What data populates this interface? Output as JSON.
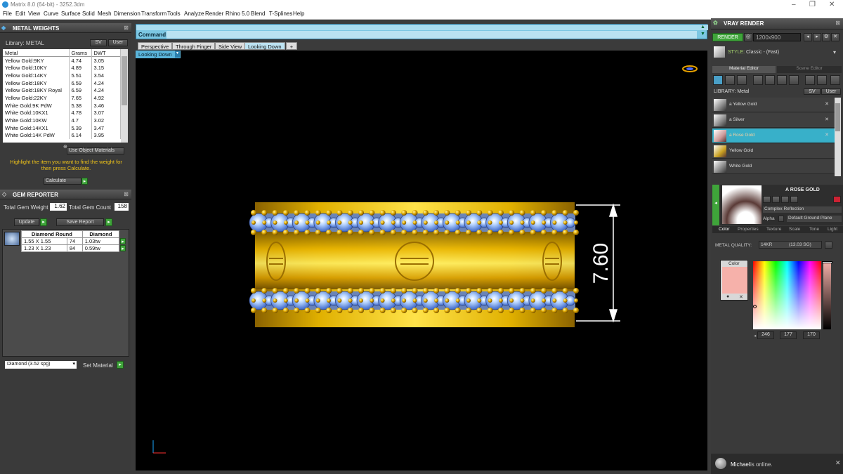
{
  "window": {
    "title": "Matrix 8.0 (64-bit) - 3252.3dm"
  },
  "menu": [
    "File",
    "Edit",
    "View",
    "Curve",
    "Surface",
    "Solid",
    "Mesh",
    "Dimension",
    "Transform",
    "Tools",
    "Analyze",
    "Render",
    "Rhino 5.0",
    "Blend",
    "T-Splines",
    "Help"
  ],
  "metal_weights": {
    "title": "METAL WEIGHTS",
    "library_label": "Library: METAL",
    "sv": "SV",
    "user": "User",
    "columns": [
      "Metal",
      "Grams",
      "DWT"
    ],
    "rows": [
      [
        "Yellow Gold:9KY",
        "4.74",
        "3.05"
      ],
      [
        "Yellow Gold:10KY",
        "4.89",
        "3.15"
      ],
      [
        "Yellow Gold:14KY",
        "5.51",
        "3.54"
      ],
      [
        "Yellow Gold:18KY",
        "6.59",
        "4.24"
      ],
      [
        "Yellow Gold:18KY Royal",
        "6.59",
        "4.24"
      ],
      [
        "Yellow Gold:22KY",
        "7.65",
        "4.92"
      ],
      [
        "White Gold:9K PdW",
        "5.38",
        "3.46"
      ],
      [
        "White Gold:10KX1",
        "4.78",
        "3.07"
      ],
      [
        "White Gold:10KW",
        "4.7",
        "3.02"
      ],
      [
        "White Gold:14KX1",
        "5.39",
        "3.47"
      ],
      [
        "White Gold:14K PdW",
        "6.14",
        "3.95"
      ]
    ],
    "use_object_materials": "Use Object Materials",
    "instruction": "Highlight the item you want to find the weight for then press Calculate.",
    "calculate": "Calculate"
  },
  "gem_reporter": {
    "title": "GEM REPORTER",
    "total_weight_label": "Total Gem Weight",
    "total_weight": "1.62",
    "total_count_label": "Total Gem Count",
    "total_count": "158",
    "update": "Update",
    "save_report": "Save Report",
    "columns": [
      "Diamond Round",
      "Diamond"
    ],
    "rows": [
      [
        "1.55 X 1.55",
        "74",
        "1.03tw"
      ],
      [
        "1.23 X 1.23",
        "84",
        "0.59tw"
      ]
    ],
    "material_select": "Diamond   (3.52 spg)",
    "set_material": "Set Material"
  },
  "command": {
    "label": "Command:"
  },
  "viewport": {
    "tabs": [
      "Perspective",
      "Through Finger",
      "Side View",
      "Looking Down"
    ],
    "add_tab": "+",
    "active_view": "Looking Down",
    "dimension": "7.60"
  },
  "vray": {
    "title": "VRAY RENDER",
    "render": "RENDER",
    "resolution": "1200x900",
    "style_label": "STYLE:",
    "style": "Classic - (Fast)",
    "tabs": [
      "Material Editor",
      "Scene Editor"
    ],
    "library_label": "LIBRARY: Metal",
    "materials": [
      "a Yellow Gold",
      "a Silver",
      "a Rose Gold",
      "Yellow Gold",
      "White Gold"
    ],
    "selected_material": "A ROSE GOLD",
    "complex_reflection": "Complex Reflection",
    "alpha": "Alpha",
    "ground_plane": "Default Ground Plane",
    "prop_tabs": [
      "Color",
      "Properties",
      "Texture",
      "Scale",
      "Tone",
      "Light"
    ],
    "metal_quality_label": "METAL QUALITY:",
    "metal_quality": "14KR",
    "metal_quality_value": "(13.03 SG)",
    "color_label": "Color",
    "rgb": [
      "246",
      "177",
      "170"
    ],
    "swatch_color": "#f6b1aa"
  },
  "notification": {
    "user": "Michael",
    "status": "is online."
  }
}
